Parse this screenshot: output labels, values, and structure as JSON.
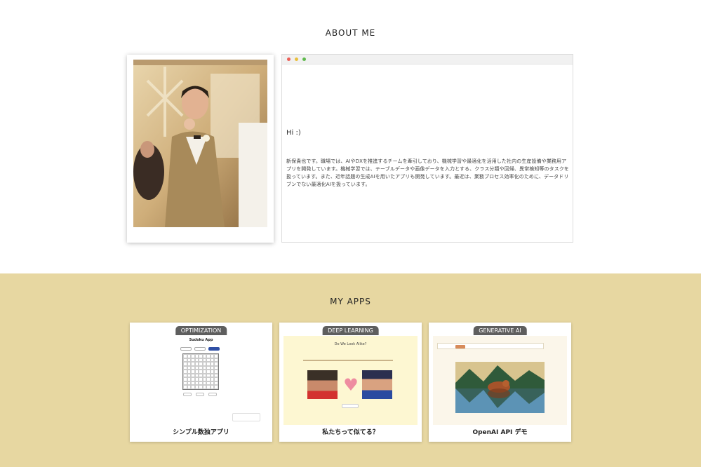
{
  "about": {
    "title": "ABOUT ME",
    "greeting": "Hi :)",
    "bio": "新保貴也です。職場では、AIやDXを推進するチームを牽引しており、機械学習や最適化を活用した社内の生産設備や業務用アプリを開発しています。機械学習では、テーブルデータや画像データを入力とする、クラス分類や回帰、異常検知等のタスクを扱っています。また、近年話題の生成AIを用いたアプリも開発しています。最近は、業務プロセス効率化のために、データドリブンでない最適化AIを扱っています。"
  },
  "apps": {
    "title": "MY APPS",
    "cards": [
      {
        "tag": "OPTIMIZATION",
        "label": "シンプル数独アプリ",
        "shot_title": "Sudoku App"
      },
      {
        "tag": "DEEP LEARNING",
        "label": "私たちって似てる？",
        "shot_title": "Do We Look Alike?"
      },
      {
        "tag": "GENERATIVE AI",
        "label": "OpenAI API デモ"
      }
    ]
  },
  "colors": {
    "apps_bg": "#e7d7a1",
    "tag_bg": "#5e5e5e",
    "win_red": "#ec5f57",
    "win_yellow": "#e9bf3c",
    "win_green": "#5fba4d"
  }
}
